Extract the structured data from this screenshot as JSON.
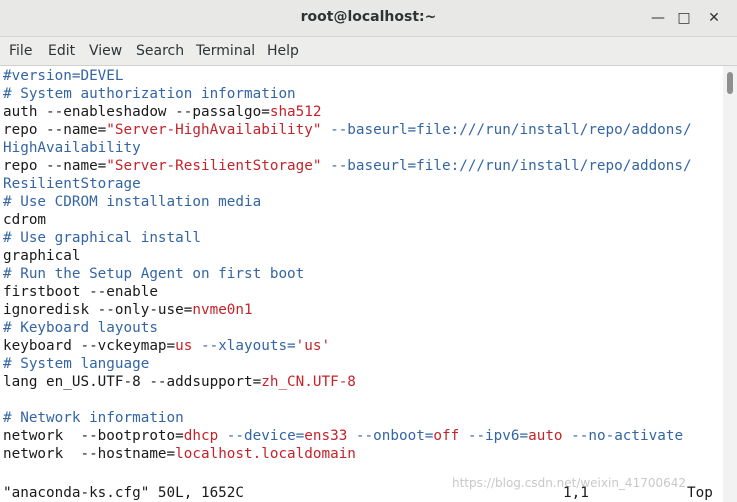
{
  "window": {
    "title": "root@localhost:~"
  },
  "menu": [
    "File",
    "Edit",
    "View",
    "Search",
    "Terminal",
    "Help"
  ],
  "lines": [
    [
      {
        "t": "#version=DEVEL",
        "c": "c"
      }
    ],
    [
      {
        "t": "# System authorization information",
        "c": "c"
      }
    ],
    [
      {
        "t": "auth --enableshadow --passalgo=",
        "c": ""
      },
      {
        "t": "sha512",
        "c": "s"
      }
    ],
    [
      {
        "t": "repo --name=",
        "c": ""
      },
      {
        "t": "\"Server-HighAvailability\"",
        "c": "s"
      },
      {
        "t": " --baseurl=",
        "c": "c"
      },
      {
        "t": "file:///run/install/repo/addons/",
        "c": "c"
      }
    ],
    [
      {
        "t": "HighAvailability",
        "c": "c"
      }
    ],
    [
      {
        "t": "repo --name=",
        "c": ""
      },
      {
        "t": "\"Server-ResilientStorage\"",
        "c": "s"
      },
      {
        "t": " --baseurl=",
        "c": "c"
      },
      {
        "t": "file:///run/install/repo/addons/",
        "c": "c"
      }
    ],
    [
      {
        "t": "ResilientStorage",
        "c": "c"
      }
    ],
    [
      {
        "t": "# Use CDROM installation media",
        "c": "c"
      }
    ],
    [
      {
        "t": "cdrom",
        "c": ""
      }
    ],
    [
      {
        "t": "# Use graphical install",
        "c": "c"
      }
    ],
    [
      {
        "t": "graphical",
        "c": ""
      }
    ],
    [
      {
        "t": "# Run the Setup Agent on first boot",
        "c": "c"
      }
    ],
    [
      {
        "t": "firstboot --enable",
        "c": ""
      }
    ],
    [
      {
        "t": "ignoredisk --only-use=",
        "c": ""
      },
      {
        "t": "nvme0n1",
        "c": "s"
      }
    ],
    [
      {
        "t": "# Keyboard layouts",
        "c": "c"
      }
    ],
    [
      {
        "t": "keyboard --vckeymap=",
        "c": ""
      },
      {
        "t": "us",
        "c": "s"
      },
      {
        "t": " --xlayouts=",
        "c": "c"
      },
      {
        "t": "'us'",
        "c": "s"
      }
    ],
    [
      {
        "t": "# System language",
        "c": "c"
      }
    ],
    [
      {
        "t": "lang en_US.UTF-8 --addsupport=",
        "c": ""
      },
      {
        "t": "zh_CN.UTF-8",
        "c": "s"
      }
    ],
    [],
    [
      {
        "t": "# Network information",
        "c": "c"
      }
    ],
    [
      {
        "t": "network  --bootproto=",
        "c": ""
      },
      {
        "t": "dhcp",
        "c": "s"
      },
      {
        "t": " --device=",
        "c": "c"
      },
      {
        "t": "ens33",
        "c": "s"
      },
      {
        "t": " --onboot=",
        "c": "c"
      },
      {
        "t": "off",
        "c": "s"
      },
      {
        "t": " --ipv6=",
        "c": "c"
      },
      {
        "t": "auto",
        "c": "s"
      },
      {
        "t": " --no-activate",
        "c": "c"
      }
    ],
    [
      {
        "t": "network  --hostname=",
        "c": ""
      },
      {
        "t": "localhost.localdomain",
        "c": "s"
      }
    ]
  ],
  "status": {
    "file": "\"anaconda-ks.cfg\" 50L, 1652C",
    "position": "1,1",
    "scroll": "Top"
  },
  "watermark": "https://blog.csdn.net/weixin_41700642"
}
